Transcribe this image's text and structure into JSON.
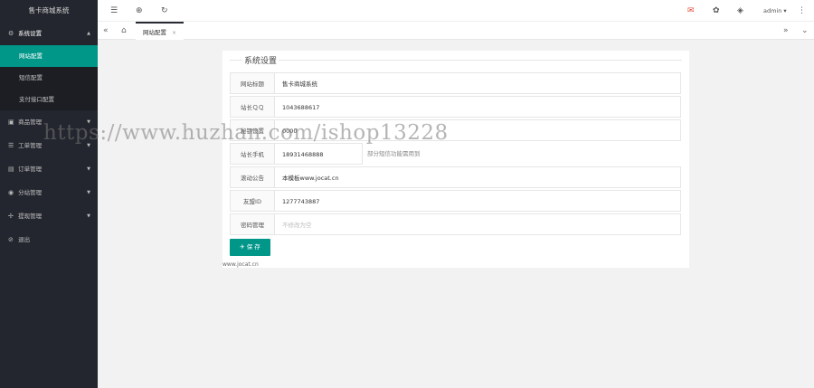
{
  "sidebar": {
    "logo": "售卡商城系统",
    "menu": [
      {
        "icon": "gear-icon",
        "glyph": "⚙",
        "label": "系统设置",
        "arrow": "▲"
      },
      {
        "icon": "goods-icon",
        "glyph": "▣",
        "label": "商品管理",
        "arrow": "▼"
      },
      {
        "icon": "ticket-icon",
        "glyph": "☰",
        "label": "工单管理",
        "arrow": "▼"
      },
      {
        "icon": "order-icon",
        "glyph": "▤",
        "label": "订单管理",
        "arrow": "▼"
      },
      {
        "icon": "share-icon",
        "glyph": "◉",
        "label": "分站管理",
        "arrow": "▼"
      },
      {
        "icon": "withdraw-icon",
        "glyph": "✢",
        "label": "提现管理",
        "arrow": "▼"
      },
      {
        "icon": "logout-icon",
        "glyph": "⊘",
        "label": "退出",
        "arrow": ""
      }
    ],
    "submenu": [
      {
        "label": "网站配置"
      },
      {
        "label": "短信配置"
      },
      {
        "label": "支付接口配置"
      }
    ]
  },
  "header": {
    "menu_glyph": "☰",
    "globe_glyph": "⊕",
    "refresh_glyph": "↻",
    "notice_glyph": "✉",
    "theme_glyph": "✿",
    "tag_glyph": "◈",
    "admin_label": "admin ▾",
    "more_glyph": "⋮"
  },
  "tabsbar": {
    "prev_glyph": "«",
    "home_glyph": "⌂",
    "tab_label": "网站配置",
    "tab_close": "×",
    "next_glyph": "»",
    "down_glyph": "⌄"
  },
  "form": {
    "title": "系统设置",
    "rows": [
      {
        "label": "网站标题",
        "value": "售卡商城系统"
      },
      {
        "label": "站长ＱＱ",
        "value": "1043688617"
      },
      {
        "label": "秘钥设置",
        "value": "0000"
      },
      {
        "label": "站长手机",
        "value": "18931468888",
        "hint": "部分短信功能需用到"
      },
      {
        "label": "滚动公告",
        "value": "本模板www.jocat.cn"
      },
      {
        "label": "友盟ID",
        "value": "1277743887"
      },
      {
        "label": "密码管理",
        "value": "",
        "placeholder": "不修改为空"
      }
    ],
    "save_label": "✈ 保 存",
    "footer": "www.jocat.cn"
  },
  "watermark": "https://www.huzhan.com/ishop13228"
}
